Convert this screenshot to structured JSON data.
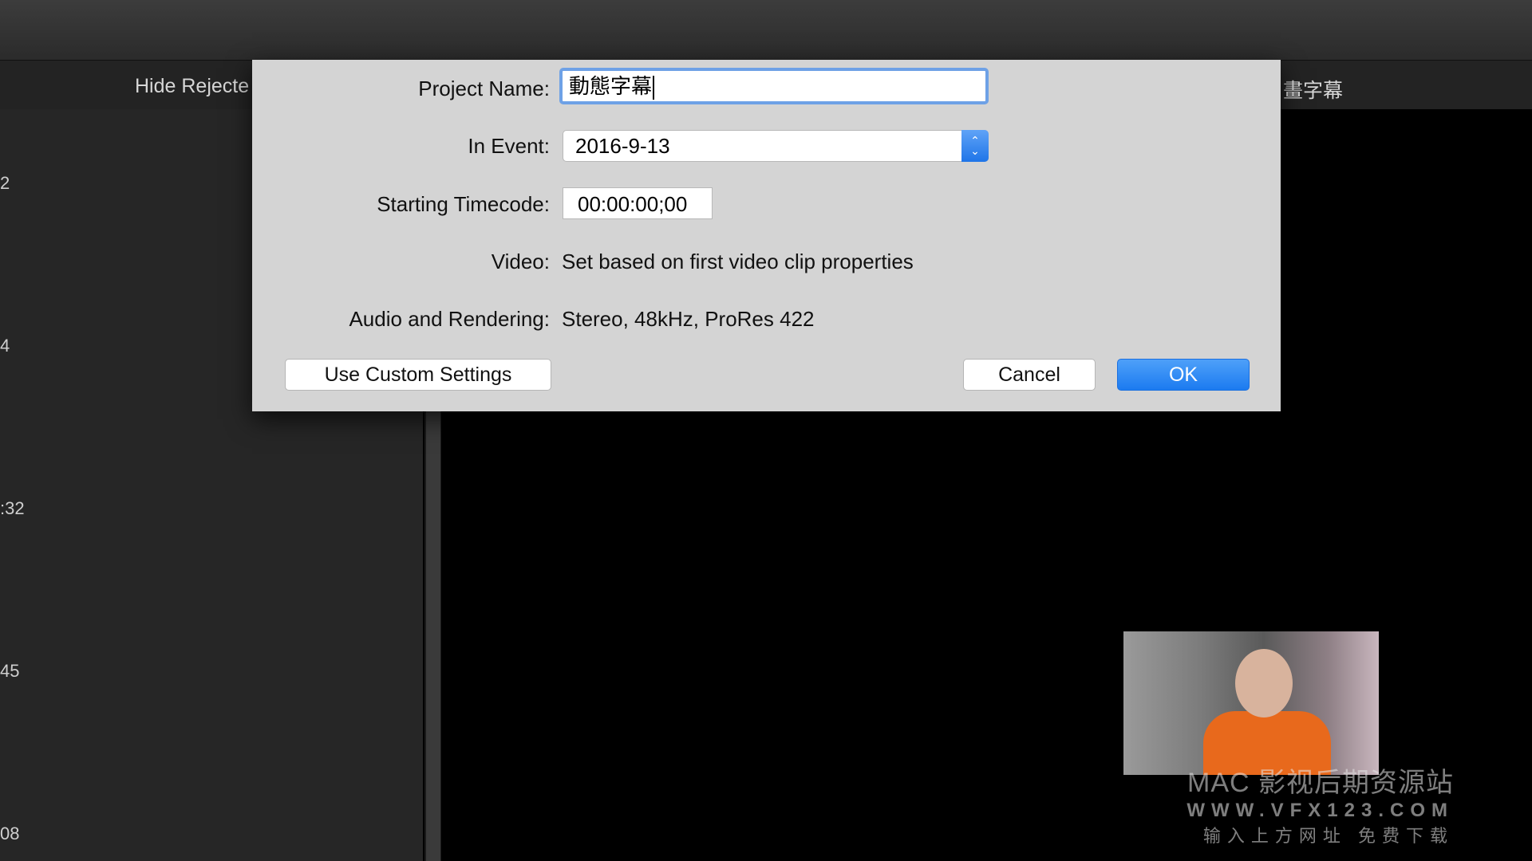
{
  "toolbar": {
    "filter_label": "Hide Rejecte",
    "project_title": "畫字幕"
  },
  "browser": {
    "durations": [
      "2",
      "4",
      ":32",
      "45",
      "08"
    ]
  },
  "dialog": {
    "project_name_label": "Project Name:",
    "project_name_value": "動態字幕",
    "in_event_label": "In Event:",
    "in_event_value": "2016-9-13",
    "timecode_label": "Starting Timecode:",
    "timecode_value": "00:00:00;00",
    "video_label": "Video:",
    "video_value": "Set based on first video clip properties",
    "audio_label": "Audio and Rendering:",
    "audio_value": "Stereo, 48kHz, ProRes 422",
    "custom_button": "Use Custom Settings",
    "cancel_button": "Cancel",
    "ok_button": "OK"
  },
  "watermark": {
    "line1": "MAC 影视后期资源站",
    "line2": "WWW.VFX123.COM",
    "line3": "输入上方网址 免费下载"
  },
  "colors": {
    "accent": "#1c7bf0",
    "dialog_bg": "#d4d4d4",
    "app_bg": "#262626"
  }
}
